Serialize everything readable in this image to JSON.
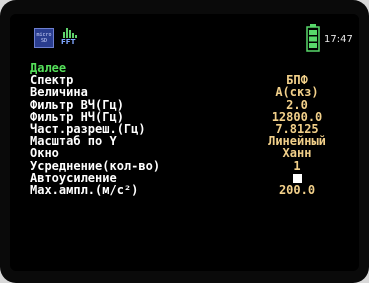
{
  "status": {
    "sd_label": "micro SD",
    "fft_label": "FFT",
    "time": "17:47",
    "battery_color": "#58d86a"
  },
  "menu": {
    "header": "Далее",
    "rows": [
      {
        "label": "Спектр",
        "value": "БПФ"
      },
      {
        "label": "Величина",
        "value": "А(скз)"
      },
      {
        "label": "Фильтр ВЧ(Гц)",
        "value": "2.0"
      },
      {
        "label": "Фильтр НЧ(Гц)",
        "value": "12800.0"
      },
      {
        "label": "Част.разреш.(Гц)",
        "value": "7.8125"
      },
      {
        "label": "Масштаб по Y",
        "value": "Линейный"
      },
      {
        "label": "Окно",
        "value": "Ханн"
      },
      {
        "label": "Усреднение(кол-во)",
        "value": "1"
      },
      {
        "label": "Автоусиление",
        "value": "",
        "checked": true
      },
      {
        "label": "Мах.ампл.(м/с²)",
        "value": "200.0"
      }
    ]
  },
  "colors": {
    "label": "#ffffff",
    "value": "#f2d08a",
    "header": "#55e05a"
  }
}
